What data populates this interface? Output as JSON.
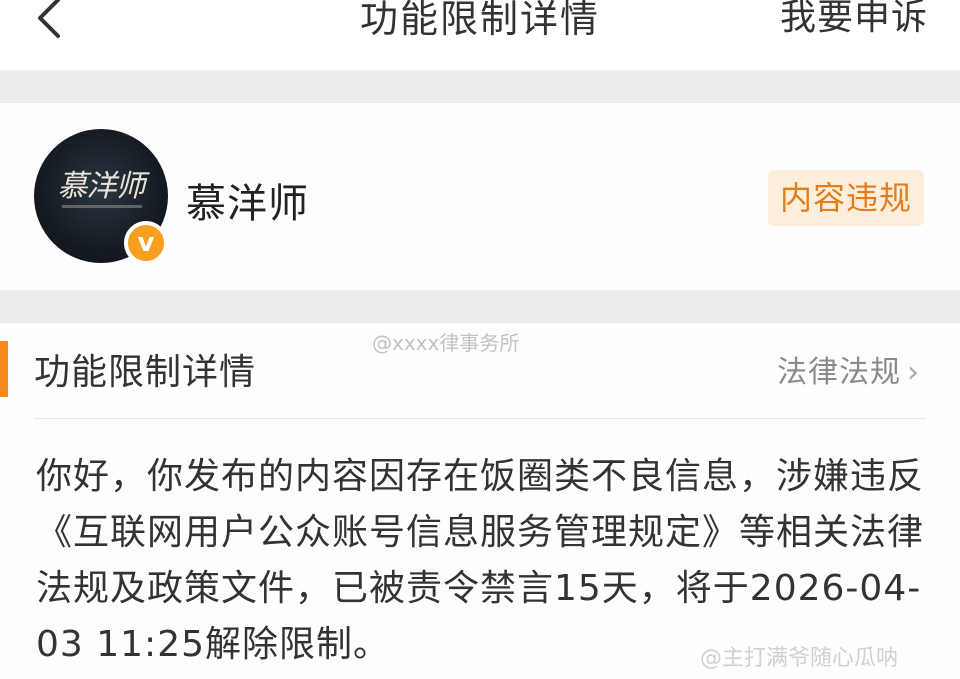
{
  "navbar": {
    "back_icon": "chevron-left-icon",
    "title": "功能限制详情",
    "appeal_label": "我要申诉"
  },
  "profile": {
    "avatar_text": "慕洋师",
    "verified_icon": "v",
    "name": "慕洋师",
    "tag": "内容违规"
  },
  "details": {
    "section_title": "功能限制详情",
    "law_link": "法律法规",
    "law_link_icon": "chevron-right-icon",
    "message": "你好，你发布的内容因存在饭圈类不良信息，涉嫌违反《互联网用户公众账号信息服务管理规定》等相关法律法规及政策文件，已被责令禁言15天，将于2026-04-03 11:25解除限制。"
  },
  "watermarks": {
    "middle": "@xxxx律事务所",
    "bottom_right": "@主打满爷随心瓜呐"
  },
  "colors": {
    "accent": "#f58a1f",
    "tag_bg": "#fbefdc",
    "tag_text": "#e37d1c",
    "badge": "#f7a01f"
  }
}
